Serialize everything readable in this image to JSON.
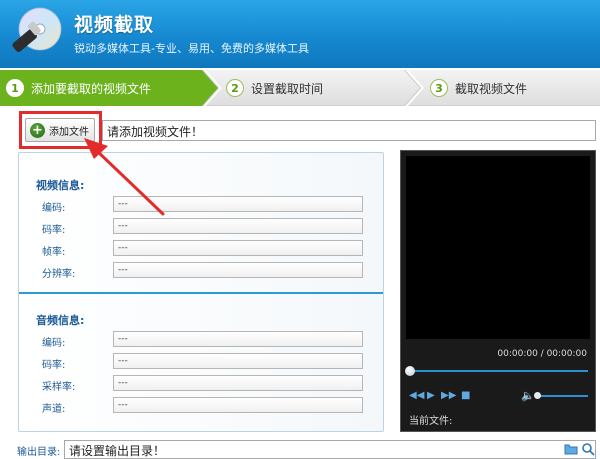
{
  "header": {
    "title": "视频截取",
    "subtitle": "锐动多媒体工具-专业、易用、免费的多媒体工具"
  },
  "steps": [
    {
      "num": "1",
      "label": "添加要截取的视频文件",
      "active": true
    },
    {
      "num": "2",
      "label": "设置截取时间",
      "active": false
    },
    {
      "num": "3",
      "label": "截取视频文件",
      "active": false
    }
  ],
  "add_file": {
    "button_label": "添加文件",
    "path_placeholder": "请添加视频文件！"
  },
  "video_info": {
    "title": "视频信息:",
    "fields": [
      {
        "label": "编码:",
        "value": "---"
      },
      {
        "label": "码率:",
        "value": "---"
      },
      {
        "label": "帧率:",
        "value": "---"
      },
      {
        "label": "分辨率:",
        "value": "---"
      }
    ]
  },
  "audio_info": {
    "title": "音频信息:",
    "fields": [
      {
        "label": "编码:",
        "value": "---"
      },
      {
        "label": "码率:",
        "value": "---"
      },
      {
        "label": "采样率:",
        "value": "---"
      },
      {
        "label": "声道:",
        "value": "---"
      }
    ]
  },
  "player": {
    "time": "00:00:00 / 00:00:00",
    "progress": 0,
    "current_file_label": "当前文件:"
  },
  "output": {
    "label": "输出目录:",
    "placeholder": "请设置输出目录！"
  },
  "colors": {
    "header_blue": "#1689d1",
    "step_active_green": "#6cb21d",
    "highlight_red": "#e42b2b"
  }
}
